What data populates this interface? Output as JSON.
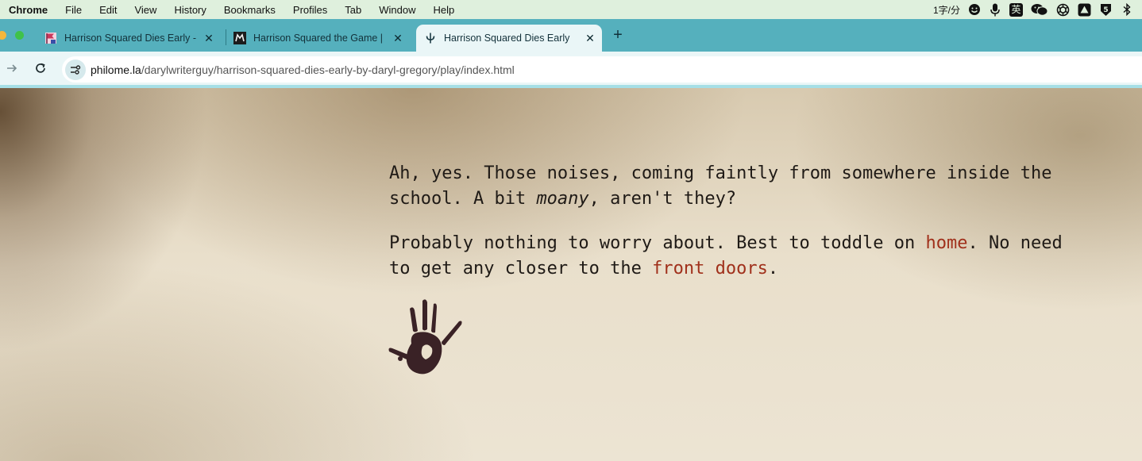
{
  "menubar": {
    "app_name": "Chrome",
    "items": [
      "File",
      "Edit",
      "View",
      "History",
      "Bookmarks",
      "Profiles",
      "Tab",
      "Window",
      "Help"
    ],
    "status_text": "1字/分",
    "status_icons": [
      "face-icon",
      "microphone-icon",
      "input-method-icon",
      "wechat-icon",
      "openai-icon",
      "drive-icon",
      "s-icon",
      "bluetooth-icon"
    ],
    "input_method_label": "英"
  },
  "tabs": [
    {
      "title": "Harrison Squared Dies Early - ",
      "active": false,
      "favicon": "pink-flag-icon"
    },
    {
      "title": "Harrison Squared the Game | ",
      "active": false,
      "favicon": "dark-logo-icon"
    },
    {
      "title": "Harrison Squared Dies Early",
      "active": true,
      "favicon": "phi-icon"
    }
  ],
  "address_bar": {
    "host": "philome.la",
    "path": "/darylwriterguy/harrison-squared-dies-early-by-daryl-gregory/play/index.html"
  },
  "story": {
    "p1_before": "Ah, yes. Those noises, coming faintly from somewhere inside the school. A bit ",
    "p1_emphasis": "moany",
    "p1_after": ", aren't they?",
    "p2_before": "Probably nothing to worry about. Best to toddle on ",
    "link_home": "home",
    "p2_middle": ". No need to get any closer to the ",
    "link_front_doors": "front doors",
    "p2_after": "."
  },
  "colors": {
    "menubar_bg": "#dff0dd",
    "tabstrip_bg": "#55b0bd",
    "toolbar_bg": "#eaf6f7",
    "link": "#a0301b",
    "text": "#1f1a16"
  }
}
